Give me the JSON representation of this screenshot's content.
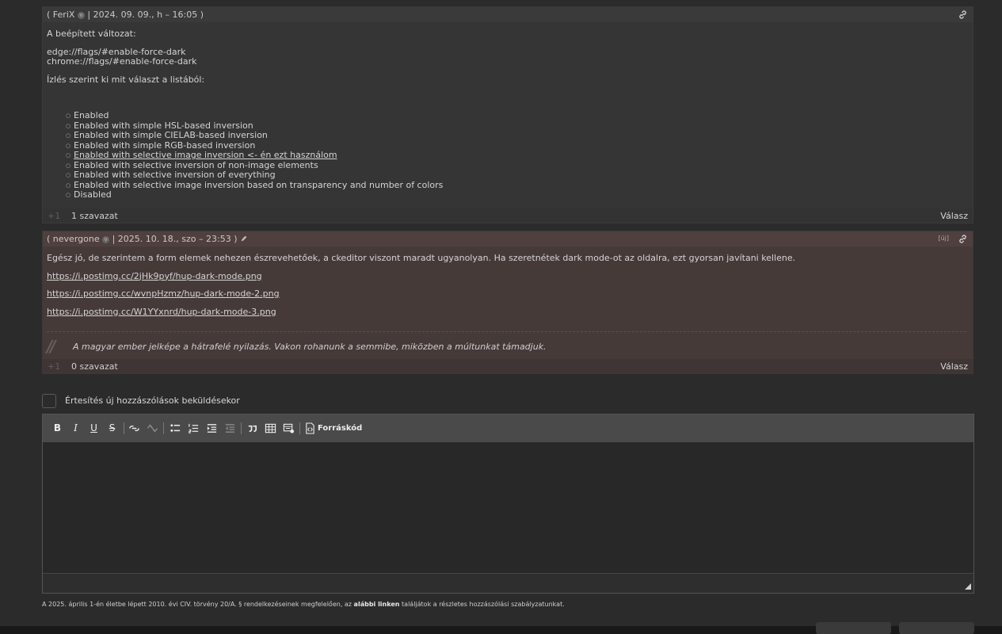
{
  "comment1": {
    "author": "FeriX",
    "datetime": "| 2024. 09. 09., h – 16:05 )",
    "intro": "A beépített változat:",
    "flag_edge": "edge://flags/#enable-force-dark",
    "flag_chrome": "chrome://flags/#enable-force-dark",
    "choice_text": "Ízlés szerint ki mit választ a listából:",
    "options": [
      "Enabled",
      "Enabled with simple HSL-based inversion",
      "Enabled with simple CIELAB-based inversion",
      "Enabled with simple RGB-based inversion",
      "Enabled with selective image inversion  <- én ezt használom",
      "Enabled with selective inversion of non-image elements",
      "Enabled with selective inversion of everything",
      "Enabled with selective image inversion based on transparency and number of colors",
      "Disabled"
    ],
    "plus_label": "+1",
    "votes": "1 szavazat",
    "reply": "Válasz"
  },
  "comment2": {
    "author": "nevergone",
    "datetime": "| 2025. 10. 18., szo – 23:53 )",
    "new_badge": "[új]",
    "text": "Egész jó, de szerintem a form elemek nehezen észrevehetőek, a ckeditor viszont maradt ugyanolyan. Ha szeretnétek dark mode-ot az oldalra, ezt gyorsan javítani kellene.",
    "links": [
      "https://i.postimg.cc/2jHk9pyf/hup-dark-mode.png",
      "https://i.postimg.cc/wvnpHzmz/hup-dark-mode-2.png",
      "https://i.postimg.cc/W1YYxnrd/hup-dark-mode-3.png"
    ],
    "quote_mark": "//",
    "signature": "A magyar ember jelképe a hátrafelé nyilazás. Vakon rohanunk a semmibe, miközben a múltunkat támadjuk.",
    "plus_label": "+1",
    "votes": "0 szavazat",
    "reply": "Válasz"
  },
  "notify": {
    "label": "Értesítés új hozzászólások beküldésekor",
    "checked": false
  },
  "editor": {
    "toolbar": {
      "bold": "B",
      "italic": "I",
      "underline": "U",
      "strike": "S",
      "source_label": "Forráskód"
    }
  },
  "legal": {
    "before": "A 2025. április 1-én életbe lépett 2010. évi CIV. törvény 20/A. § rendelkezéseinek megfelelően, az",
    "link": "alábbi linken",
    "after": "találjátok a részletes hozzászólási szabályzatunkat."
  },
  "icons": [
    "user-badge-icon",
    "link-icon",
    "edit-icon",
    "bold-icon",
    "italic-icon",
    "underline-icon",
    "strike-icon",
    "link-insert-icon",
    "unlink-icon",
    "bulleted-list-icon",
    "numbered-list-icon",
    "indent-icon",
    "outdent-icon",
    "blockquote-icon",
    "table-icon",
    "media-icon",
    "source-icon",
    "resize-icon"
  ]
}
